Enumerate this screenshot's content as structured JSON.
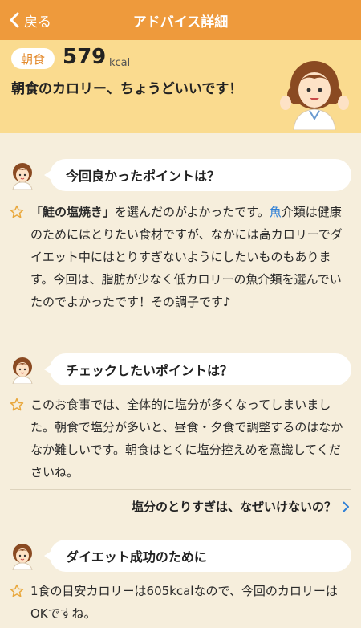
{
  "nav": {
    "back_label": "戻る",
    "title": "アドバイス詳細"
  },
  "summary": {
    "meal": "朝食",
    "kcal": "579",
    "kcal_unit": "kcal",
    "message": "朝食のカロリー、ちょうどいいです！"
  },
  "sections": [
    {
      "heading": "今回良かったポイントは？",
      "highlight": "「鮭の塩焼き」",
      "text_a": "を選んだのがよかったです。",
      "link": "魚",
      "text_b": "介類は健康のためにはとりたい食材ですが、なかには高カロリーでダイエット中にはとりすぎないようにしたいものもあります。今回は、脂肪が少なく低カロリーの魚介類を選んでいたのでよかったです！その調子です♪"
    },
    {
      "heading": "チェックしたいポイントは？",
      "text": "このお食事では、全体的に塩分が多くなってしまいました。朝食で塩分が多いと、昼食・夕食で調整するのはなかなか難しいです。朝食はとくに塩分控えめを意識してくださいね。",
      "more_link": "塩分のとりすぎは、なぜいけないの？"
    },
    {
      "heading": "ダイエット成功のために",
      "text": "1食の目安カロリーは605kcalなので、今回のカロリーはOKですね。"
    }
  ],
  "icons": {
    "back": "chevron-left-icon",
    "star": "star-outline-icon",
    "more": "chevron-right-icon",
    "advisor": "advisor-avatar-icon"
  },
  "colors": {
    "header": "#ee9a3c",
    "summary_bg": "#fadb8f",
    "page_bg": "#f6eedc",
    "badge_text": "#e38a2c",
    "link": "#2e7fd6",
    "star": "#e9a73b"
  }
}
